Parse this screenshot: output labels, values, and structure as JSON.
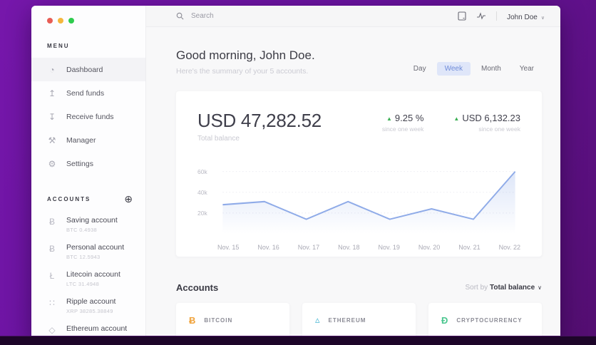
{
  "colors": {
    "traffic_red": "#e85d55",
    "traffic_yellow": "#f5b73d",
    "traffic_green": "#2ecc4e",
    "accent_blue": "#8fabe8",
    "tab_active_bg": "#dfe6f9",
    "tab_active_text": "#6f8bd8",
    "positive_green": "#3cb054"
  },
  "sidebar": {
    "menu_label": "MENU",
    "menu_items": [
      {
        "icon": "dashboard-icon",
        "glyph": "◔",
        "label": "Dashboard",
        "active": true
      },
      {
        "icon": "send-funds-icon",
        "glyph": "↥",
        "label": "Send funds",
        "active": false
      },
      {
        "icon": "receive-funds-icon",
        "glyph": "↧",
        "label": "Receive funds",
        "active": false
      },
      {
        "icon": "manager-icon",
        "glyph": "⚒",
        "label": "Manager",
        "active": false
      },
      {
        "icon": "settings-icon",
        "glyph": "⚙",
        "label": "Settings",
        "active": false
      }
    ],
    "accounts_label": "ACCOUNTS",
    "add_account_glyph": "⊕",
    "accounts": [
      {
        "icon": "bitcoin-icon",
        "glyph": "Ƀ",
        "name": "Saving account",
        "detail": "BTC 0.4938"
      },
      {
        "icon": "bitcoin-icon",
        "glyph": "Ƀ",
        "name": "Personal account",
        "detail": "BTC 12.5943"
      },
      {
        "icon": "litecoin-icon",
        "glyph": "Ł",
        "name": "Litecoin account",
        "detail": "LTC 31.4948"
      },
      {
        "icon": "ripple-icon",
        "glyph": "∷",
        "name": "Ripple account",
        "detail": "XRP 38285.38849"
      },
      {
        "icon": "ethereum-icon",
        "glyph": "◇",
        "name": "Ethereum account",
        "detail": ""
      }
    ]
  },
  "header": {
    "search_placeholder": "Search",
    "user_name": "John Doe",
    "dropdown_glyph": "∨"
  },
  "main": {
    "greeting": "Good morning, John Doe.",
    "subtitle": "Here's the summary of your 5 accounts.",
    "range_tabs": [
      {
        "label": "Day",
        "active": false
      },
      {
        "label": "Week",
        "active": true
      },
      {
        "label": "Month",
        "active": false
      },
      {
        "label": "Year",
        "active": false
      }
    ],
    "balance": {
      "amount": "USD 47,282.52",
      "label": "Total balance",
      "changes": [
        {
          "direction": "up",
          "value": "9.25 %",
          "sub": "since one week"
        },
        {
          "direction": "up",
          "value": "USD 6,132.23",
          "sub": "since one week"
        }
      ]
    },
    "accounts_section": {
      "title": "Accounts",
      "sort_prefix": "Sort by",
      "sort_value": "Total balance",
      "sort_chevron": "∨",
      "cards": [
        {
          "icon": "bitcoin-icon",
          "glyph": "Ƀ",
          "label": "BITCOIN",
          "color": "#f0a33c"
        },
        {
          "icon": "ethereum-icon",
          "glyph": "▵",
          "label": "ETHEREUM",
          "color": "#4bb8d4"
        },
        {
          "icon": "dash-icon",
          "glyph": "Ð",
          "label": "CRYPTOCURRENCY",
          "color": "#4cc790"
        }
      ]
    }
  },
  "chart_data": {
    "type": "area",
    "title": "Total balance over one week (USD)",
    "x": [
      "Nov. 15",
      "Nov. 16",
      "Nov. 17",
      "Nov. 18",
      "Nov. 19",
      "Nov. 20",
      "Nov. 21",
      "Nov. 22"
    ],
    "values": [
      28000,
      31000,
      14000,
      31000,
      14000,
      24000,
      14000,
      60000
    ],
    "yticks": [
      {
        "label": "20k",
        "value": 20000
      },
      {
        "label": "40k",
        "value": 40000
      },
      {
        "label": "60k",
        "value": 60000
      }
    ],
    "ylim": [
      0,
      70000
    ],
    "grid": "dotted",
    "legend": "none",
    "line_color": "#8fabe8",
    "fill_top_opacity": 0.3
  }
}
